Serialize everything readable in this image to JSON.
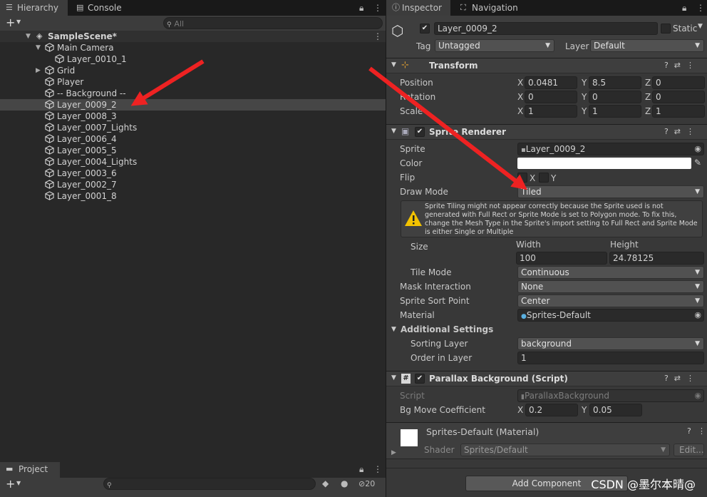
{
  "hierarchy_tab": {
    "label": "Hierarchy",
    "icon": "list-icon"
  },
  "console_tab": {
    "label": "Console",
    "icon": "console-icon"
  },
  "hierarchy_search": {
    "placeholder": "All"
  },
  "scene": {
    "name": "SampleScene*"
  },
  "hierarchy_items": [
    {
      "label": "Main Camera"
    },
    {
      "label": "Layer_0010_1"
    },
    {
      "label": "Grid"
    },
    {
      "label": "Player"
    },
    {
      "label": "-- Background --"
    },
    {
      "label": "Layer_0009_2"
    },
    {
      "label": "Layer_0008_3"
    },
    {
      "label": "Layer_0007_Lights"
    },
    {
      "label": "Layer_0006_4"
    },
    {
      "label": "Layer_0005_5"
    },
    {
      "label": "Layer_0004_Lights"
    },
    {
      "label": "Layer_0003_6"
    },
    {
      "label": "Layer_0002_7"
    },
    {
      "label": "Layer_0001_8"
    }
  ],
  "project_tab": {
    "label": "Project"
  },
  "project_badge": "20",
  "inspector_tab": {
    "label": "Inspector"
  },
  "navigation_tab": {
    "label": "Navigation"
  },
  "object": {
    "name": "Layer_0009_2",
    "static_label": "Static",
    "tag_label": "Tag",
    "tag_value": "Untagged",
    "layer_label": "Layer",
    "layer_value": "Default"
  },
  "transform": {
    "title": "Transform",
    "position_label": "Position",
    "rotation_label": "Rotation",
    "scale_label": "Scale",
    "axis_x": "X",
    "axis_y": "Y",
    "axis_z": "Z",
    "position": {
      "x": "0.0481",
      "y": "8.5",
      "z": "0"
    },
    "rotation": {
      "x": "0",
      "y": "0",
      "z": "0"
    },
    "scale": {
      "x": "1",
      "y": "1",
      "z": "1"
    }
  },
  "sprite_renderer": {
    "title": "Sprite Renderer",
    "sprite_label": "Sprite",
    "sprite_value": "Layer_0009_2",
    "color_label": "Color",
    "color_value": "#ffffff",
    "flip_label": "Flip",
    "flip_x": "X",
    "flip_y": "Y",
    "draw_mode_label": "Draw Mode",
    "draw_mode_value": "Tiled",
    "warning_lines": [
      "Sprite Tiling might not appear correctly because the Sprite used is not",
      "generated with Full Rect or Sprite Mode is set to Polygon mode. To fix this,",
      "change the Mesh Type in the Sprite's import setting to Full Rect and Sprite Mode",
      "is either Single or Multiple"
    ],
    "size_label": "Size",
    "width_label": "Width",
    "height_label": "Height",
    "width_value": "100",
    "height_value": "24.78125",
    "tile_mode_label": "Tile Mode",
    "tile_mode_value": "Continuous",
    "mask_label": "Mask Interaction",
    "mask_value": "None",
    "sort_point_label": "Sprite Sort Point",
    "sort_point_value": "Center",
    "material_label": "Material",
    "material_value": "Sprites-Default",
    "additional_label": "Additional Settings",
    "sorting_layer_label": "Sorting Layer",
    "sorting_layer_value": "background",
    "order_label": "Order in Layer",
    "order_value": "1"
  },
  "parallax": {
    "title": "Parallax Background (Script)",
    "script_label": "Script",
    "script_value": "ParallaxBackground",
    "coef_label": "Bg Move Coefficient",
    "coef_x_label": "X",
    "coef_y_label": "Y",
    "coef_x": "0.2",
    "coef_y": "0.05"
  },
  "material": {
    "title": "Sprites-Default (Material)",
    "shader_label": "Shader",
    "shader_value": "Sprites/Default",
    "edit_label": "Edit..."
  },
  "add_component_label": "Add Component",
  "watermark": "CSDN @墨尔本晴@",
  "colors": {
    "arrow": "#ee2222",
    "selection": "#464646",
    "warning": "#f2c200"
  }
}
